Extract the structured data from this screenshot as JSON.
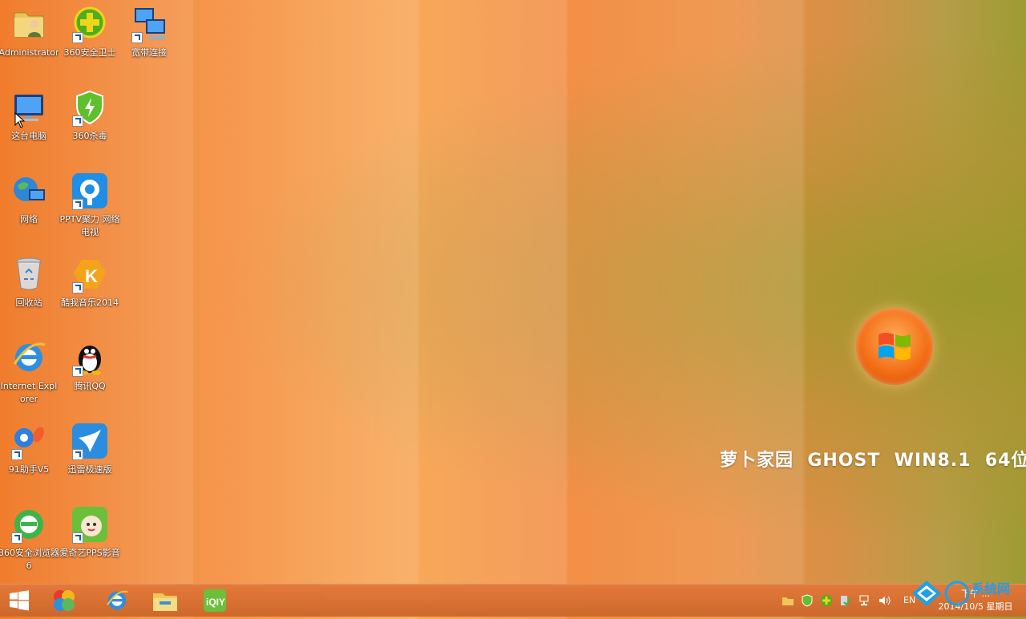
{
  "desktop": {
    "icons": [
      {
        "label": "Administrator",
        "name": "administrator-folder-icon"
      },
      {
        "label": "360安全卫士",
        "name": "360-security-icon"
      },
      {
        "label": "宽带连接",
        "name": "broadband-connection-icon"
      },
      {
        "label": "这台电脑",
        "name": "this-pc-icon"
      },
      {
        "label": "360杀毒",
        "name": "360-antivirus-icon"
      },
      {
        "label": "网络",
        "name": "network-icon"
      },
      {
        "label": "PPTV聚力 网络电视",
        "name": "pptv-icon"
      },
      {
        "label": "回收站",
        "name": "recycle-bin-icon"
      },
      {
        "label": "酷我音乐2014",
        "name": "kuwo-music-icon"
      },
      {
        "label": "Internet Explorer",
        "name": "internet-explorer-icon"
      },
      {
        "label": "腾讯QQ",
        "name": "tencent-qq-icon"
      },
      {
        "label": "91助手V5",
        "name": "91-assistant-icon"
      },
      {
        "label": "迅雷极速版",
        "name": "xunlei-icon"
      },
      {
        "label": "360安全浏览器6",
        "name": "360-browser-icon"
      },
      {
        "label": "爱奇艺PPS影音",
        "name": "iqiyi-pps-icon"
      }
    ],
    "brand_text": "萝卜家园  GHOST  WIN8.1  64位"
  },
  "taskbar": {
    "language": "EN",
    "clock_time": "下午 ...",
    "clock_date": "2014/10/5 星期日"
  },
  "watermark": {
    "text": "系统网"
  },
  "colors": {
    "accent": "#f58a34",
    "taskbar": "#d96f30"
  }
}
